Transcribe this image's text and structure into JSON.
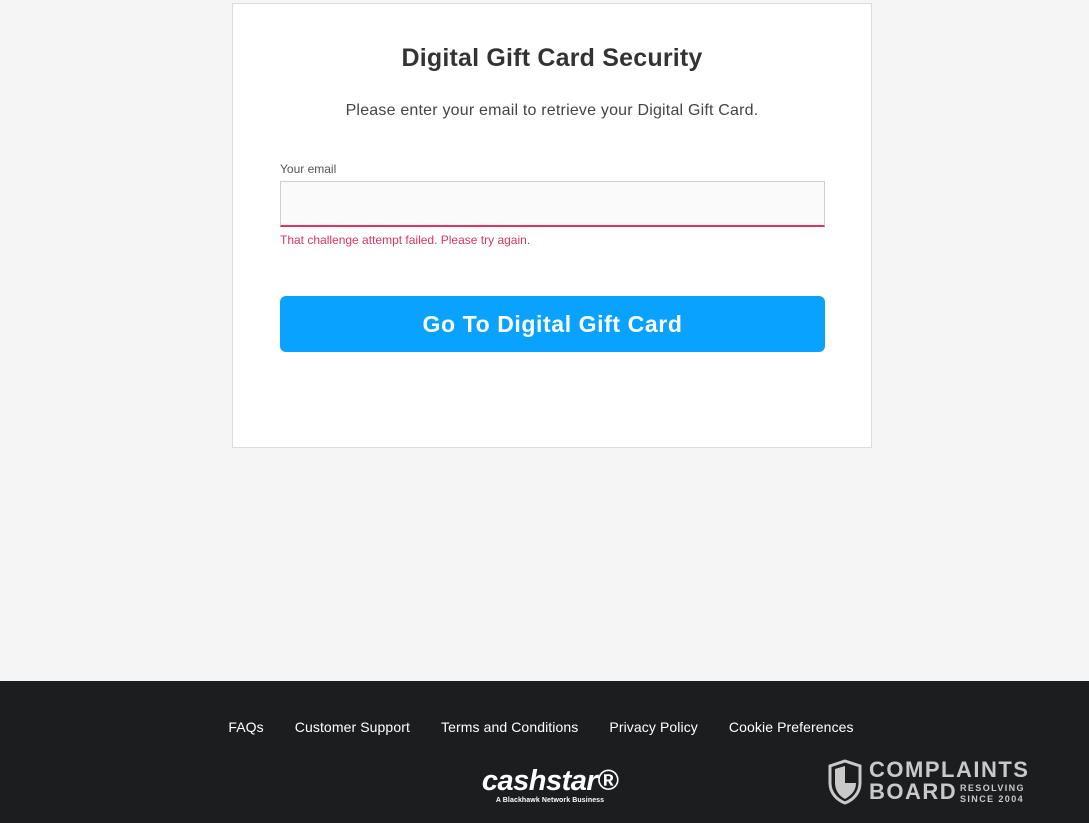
{
  "card": {
    "title": "Digital Gift Card Security",
    "subtitle": "Please enter your email to retrieve your Digital Gift Card.",
    "email_label": "Your email",
    "email_value": "",
    "email_placeholder": "",
    "error_message": "That challenge attempt failed. Please try again.",
    "submit_label": "Go To Digital Gift Card"
  },
  "footer": {
    "links": [
      "FAQs",
      "Customer Support",
      "Terms and Conditions",
      "Privacy Policy",
      "Cookie Preferences"
    ],
    "brand_logo": {
      "wordmark": "cashstar®",
      "tagline": "A Blackhawk Network Business"
    },
    "watermark": {
      "line1": "COMPLAINTS",
      "line2": "BOARD",
      "side_line1": "RESOLVING",
      "side_line2": "SINCE 2004",
      "icon": "shield-icon"
    }
  },
  "colors": {
    "accent": "#0aa2ff",
    "error": "#d9365e",
    "footer_bg": "#1c1d1f",
    "page_bg": "#f5f5f5"
  }
}
